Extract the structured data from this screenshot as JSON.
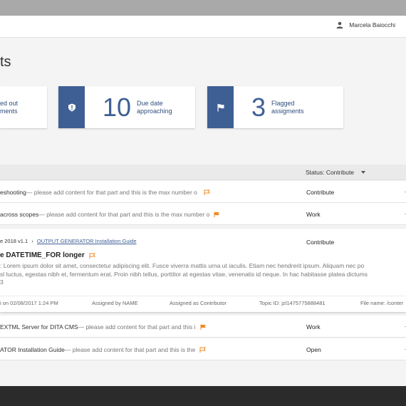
{
  "header": {
    "user_name": "Marcela Baiocchi"
  },
  "page": {
    "title": "ts"
  },
  "cards": [
    {
      "label": "ed out\nments",
      "count": ""
    },
    {
      "count": "10",
      "label": "Due date\napproaching",
      "icon": "alert-icon"
    },
    {
      "count": "3",
      "label": "Flagged\nassigments",
      "icon": "flag-icon"
    }
  ],
  "list": {
    "status_filter": "Status: Contribute"
  },
  "rows": [
    {
      "title": "eshooting",
      "desc": " — please add content for that part and this is the max number o",
      "status": "Contribute",
      "flag": "outline"
    },
    {
      "title": "across scopes",
      "desc": " — please add content for that part and this is the max number o",
      "status": "Work",
      "flag": "filled"
    },
    {
      "title": "EXTML Server for DITA CMS",
      "desc": " — please add content for that part and this i",
      "status": "Work",
      "flag": "filled"
    },
    {
      "title": "ATOR Installation Guide",
      "desc": " — please add content for that part and this is the",
      "status": "Open",
      "flag": "outline"
    }
  ],
  "expanded": {
    "breadcrumb_prefix": "e 2018 v1.1",
    "breadcrumb_sep": "›",
    "breadcrumb_link": "OUTPUT GENERATOR Installation Guide",
    "status": "Contribute",
    "title": "e DATETIME_FOR longer",
    "desc_line1": ": Lorem ipsum dolor sit amet, consectetur adipiscing elit. Fusce viverra mattis urna ut iaculis. Etiam nec hendrerit ipsum. Aliquam nec po",
    "desc_line2": "sl luctus, egestas nibh et, fermentum erat. Proin nibh tellus, porttitor at egestas vitae, venenatis id neque. In hac habitasse platea dictums",
    "desc_line3": "3",
    "meta_date": "i on 02/08/2017 1:24 PM",
    "meta_assigned": "Assigned by NAME",
    "meta_role": "Assigned as Contributor",
    "meta_topic": "Topic ID: jzl1475775888481",
    "meta_file": "File name: /conter"
  },
  "colors": {
    "accent": "#3e5f94",
    "flag": "#f08a24"
  }
}
